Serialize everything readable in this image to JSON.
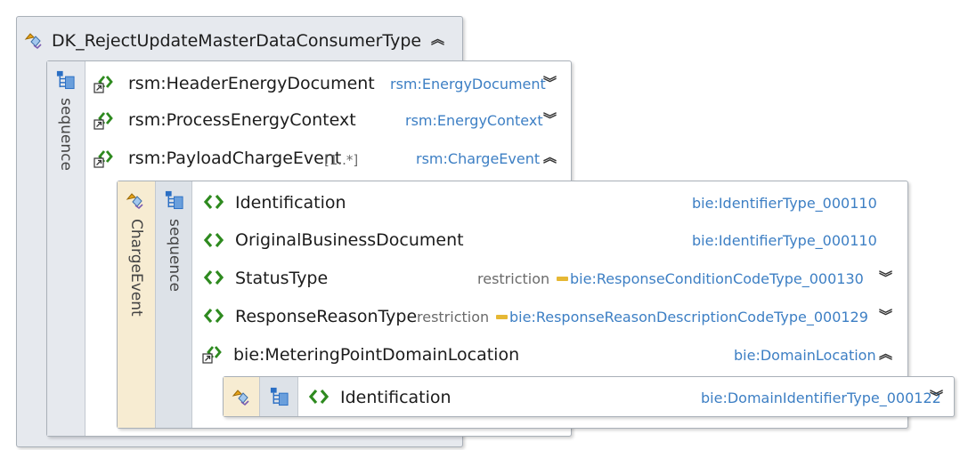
{
  "complex_type": {
    "title": "DK_RejectUpdateMasterDataConsumerType",
    "compositor": "sequence"
  },
  "outer_elements": [
    {
      "name": "rsm:HeaderEnergyDocument",
      "type": "rsm:EnergyDocument",
      "cardinality": "",
      "state": "collapsed"
    },
    {
      "name": "rsm:ProcessEnergyContext",
      "type": "rsm:EnergyContext",
      "cardinality": "",
      "state": "collapsed"
    },
    {
      "name": "rsm:PayloadChargeEvent",
      "type": "rsm:ChargeEvent",
      "cardinality": "[1..*]",
      "state": "expanded"
    }
  ],
  "charge_event": {
    "label": "ChargeEvent",
    "compositor": "sequence",
    "elements": [
      {
        "name": "Identification",
        "type": "bie:IdentifierType_000110",
        "prefix": ""
      },
      {
        "name": "OriginalBusinessDocument",
        "type": "bie:IdentifierType_000110",
        "prefix": ""
      },
      {
        "name": "StatusType",
        "type": "bie:ResponseConditionCodeType_000130",
        "prefix": "restriction"
      },
      {
        "name": "ResponseReasonType",
        "type": "bie:ResponseReasonDescriptionCodeType_000129",
        "prefix": "restriction"
      },
      {
        "name": "bie:MeteringPointDomainLocation",
        "type": "bie:DomainLocation",
        "prefix": ""
      }
    ]
  },
  "domain_location": {
    "elements": [
      {
        "name": "Identification",
        "type": "bie:DomainIdentifierType_000122"
      }
    ]
  },
  "icons": {
    "complex_type": "complex-type-icon",
    "sequence": "sequence-icon",
    "element_ref": "element-reference-icon",
    "element": "element-icon",
    "expand": "chevron-double-down-icon",
    "collapse": "chevron-double-up-icon"
  },
  "colors": {
    "type_text": "#3d7fc4",
    "border": "#a9b0b8",
    "outer_band": "#e6e9ee",
    "charge_band": "#f7ecd2",
    "sequence_band": "#dde2e8",
    "element_icon": "#2e8a1f",
    "restriction_marker": "#e6b834"
  }
}
